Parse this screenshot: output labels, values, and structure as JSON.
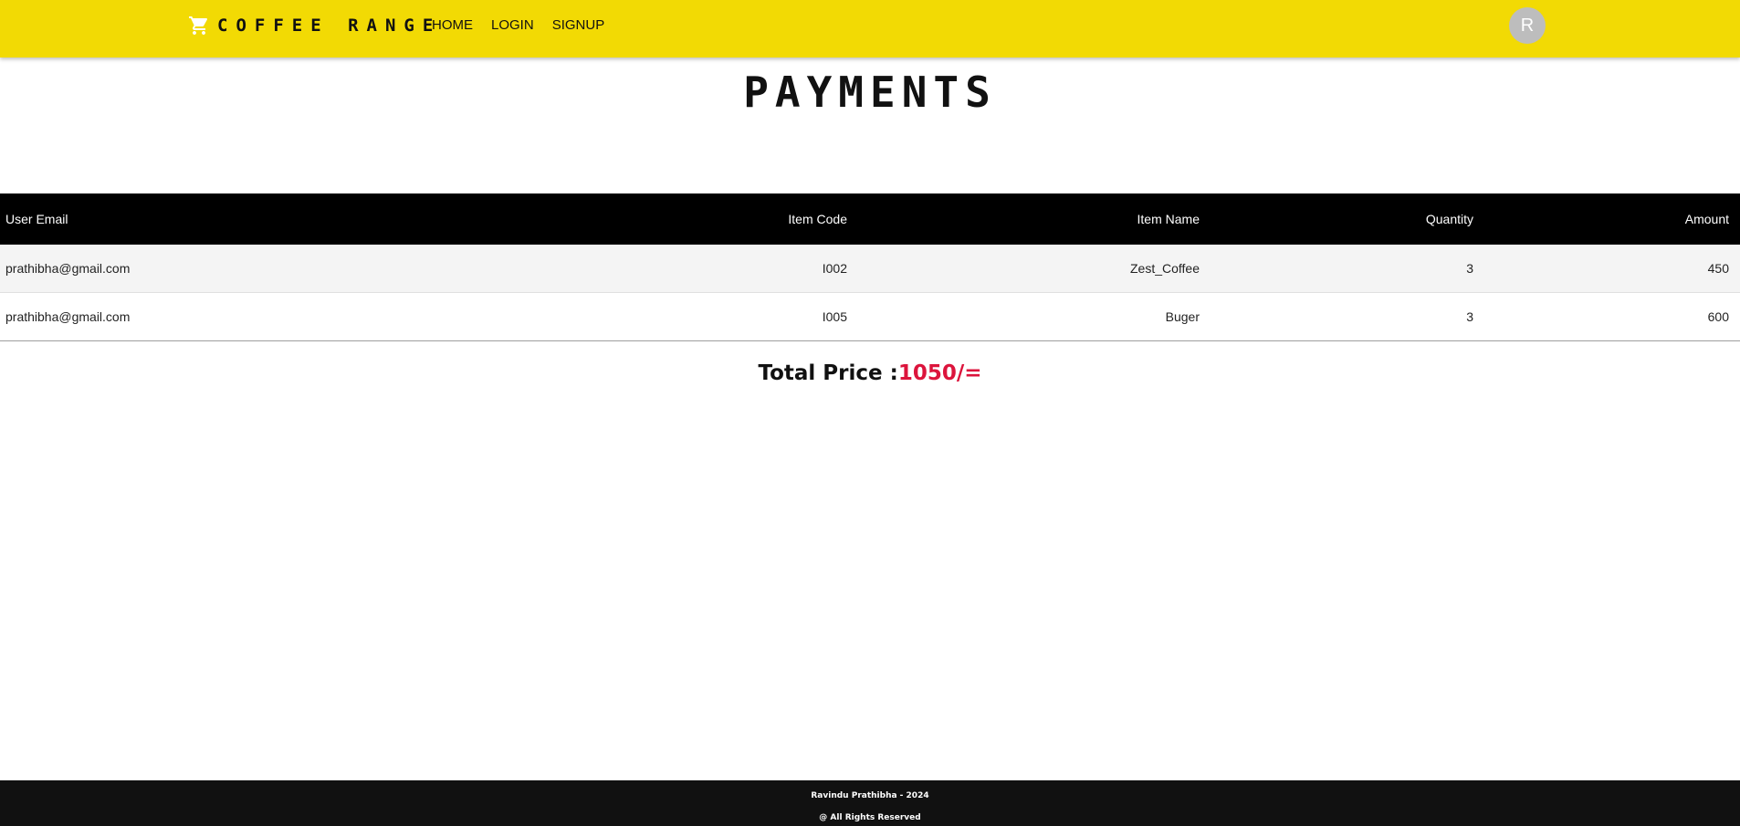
{
  "header": {
    "brand": "COFFEE RANGE",
    "cart_icon": "shopping-cart-icon",
    "nav": [
      "HOME",
      "LOGIN",
      "SIGNUP"
    ],
    "avatar_initial": "R",
    "background_color": "#f2da04"
  },
  "page": {
    "title": "PAYMENTS"
  },
  "table": {
    "columns": [
      "User Email",
      "Item Code",
      "Item Name",
      "Quantity",
      "Amount"
    ],
    "rows": [
      [
        "prathibha@gmail.com",
        "I002",
        "Zest_Coffee",
        "3",
        "450"
      ],
      [
        "prathibha@gmail.com",
        "I005",
        "Buger",
        "3",
        "600"
      ]
    ]
  },
  "total": {
    "label": "Total Price :",
    "value": "1050/=",
    "value_color": "#dc143c"
  },
  "footer": {
    "line1": "Ravindu Prathibha - 2024",
    "line2": "@ All Rights Reserved"
  }
}
